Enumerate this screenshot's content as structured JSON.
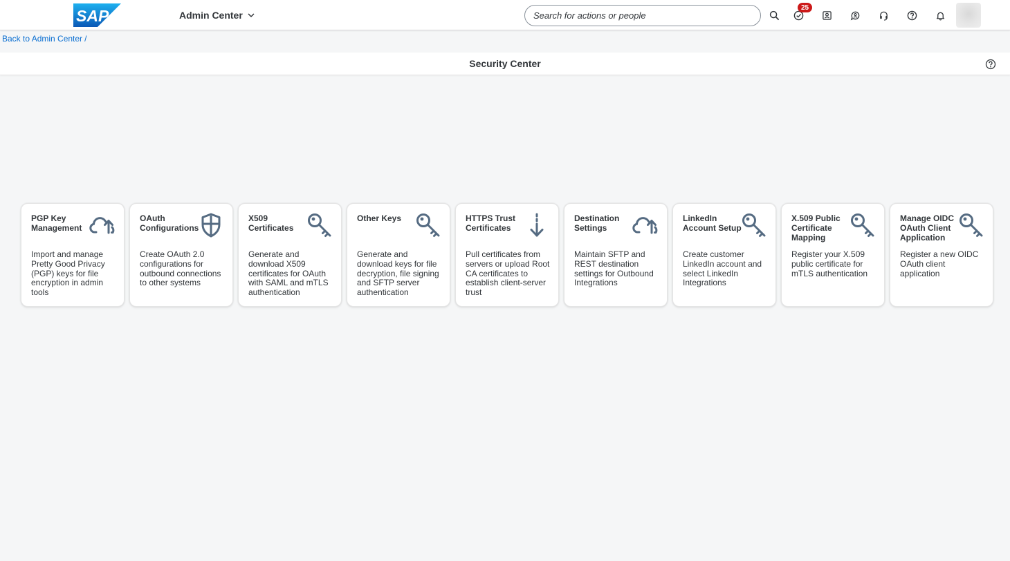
{
  "shell": {
    "logo_text": "SAP",
    "product": "Admin Center",
    "search_placeholder": "Search for actions or people",
    "notification_count": "25",
    "icons": [
      "search-icon",
      "task-check-icon",
      "contact-card-icon",
      "chat-bot-icon",
      "headset-icon",
      "help-icon",
      "bell-icon"
    ]
  },
  "breadcrumb": {
    "back_link": "Back to Admin Center",
    "separator": "/"
  },
  "page": {
    "title": "Security Center"
  },
  "tiles": [
    {
      "title": "PGP Key Management",
      "description": "Import and manage Pretty Good Privacy (PGP) keys for file encryption in admin tools",
      "icon": "cloud-upload-icon"
    },
    {
      "title": "OAuth Configurations",
      "description": "Create OAuth 2.0 configurations for outbound connections to other systems",
      "icon": "shield-icon"
    },
    {
      "title": "X509 Certificates",
      "description": "Generate and download X509 certificates for OAuth with SAML and mTLS authentication",
      "icon": "key-icon"
    },
    {
      "title": "Other Keys",
      "description": "Generate and download keys for file decryption, file signing and SFTP server authentication",
      "icon": "key-icon"
    },
    {
      "title": "HTTPS Trust Certificates",
      "description": "Pull certificates from servers or upload Root CA certificates to establish client-server trust",
      "icon": "download-arrow-icon"
    },
    {
      "title": "Destination Settings",
      "description": "Maintain SFTP and REST destination settings for Outbound Integrations",
      "icon": "cloud-upload-icon"
    },
    {
      "title": "LinkedIn Account Setup",
      "description": "Create customer LinkedIn account and select LinkedIn Integrations",
      "icon": "key-icon"
    },
    {
      "title": "X.509 Public Certificate Mapping",
      "description": "Register your X.509 public certificate for mTLS authentication",
      "icon": "key-icon"
    },
    {
      "title": "Manage OIDC OAuth Client Application",
      "description": "Register a new OIDC OAuth client application",
      "icon": "key-icon"
    }
  ],
  "colors": {
    "brand_blue": "#0a6ed1",
    "badge_red": "#cc1919",
    "text": "#32363a",
    "icon": "#556b82"
  }
}
